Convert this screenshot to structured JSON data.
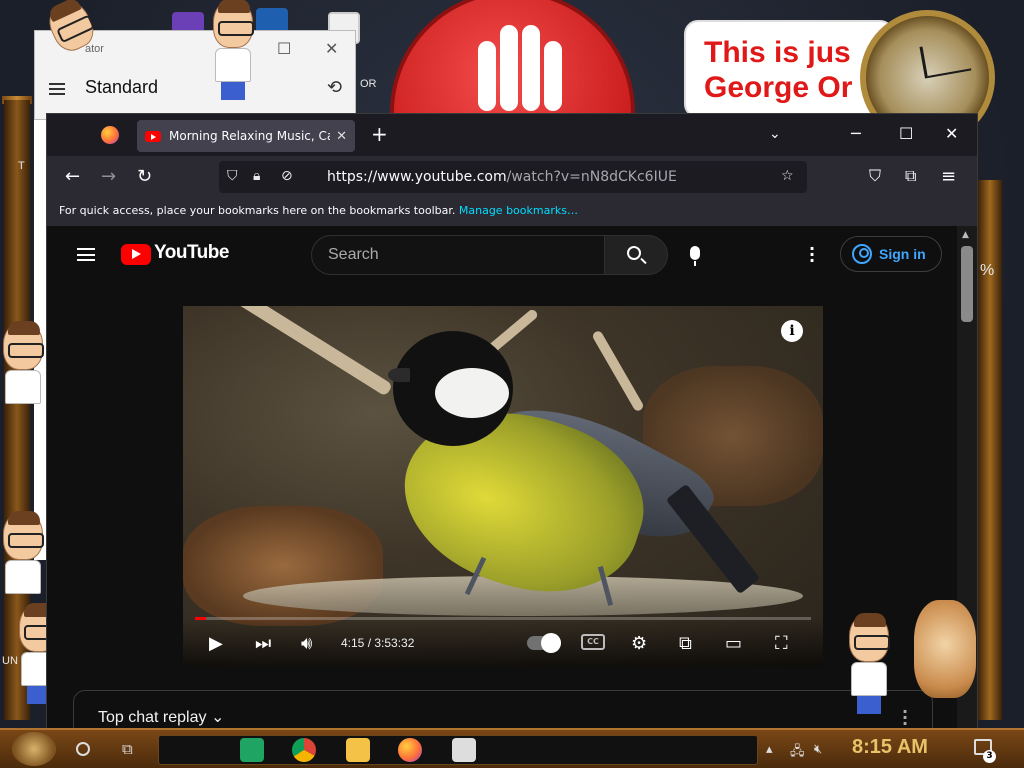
{
  "calculator": {
    "title": "ator",
    "mode": "Standard"
  },
  "desktop": {
    "orwell_line1": "This is jus",
    "orwell_line2": "George Or",
    "side_label_t": "T",
    "side_label_un": "UN",
    "side_label_or": "OR",
    "side_label_pct": "%"
  },
  "browser": {
    "tab_title": "Morning Relaxing Music, Calm",
    "url_host": "https://www.youtube.com",
    "url_path": "/watch?v=nN8dCKc6IUE",
    "bookmarks_text": "For quick access, place your bookmarks here on the bookmarks toolbar.",
    "bookmarks_link": "Manage bookmarks…"
  },
  "youtube": {
    "logo_text": "YouTube",
    "search_placeholder": "Search",
    "sign_in_label": "Sign in",
    "info_glyph": "i",
    "player": {
      "current_time": "4:15",
      "duration": "3:53:32",
      "time_display": "4:15 / 3:53:32",
      "progress_fraction": 0.018,
      "cc_label": "CC"
    },
    "chat_label": "Top chat replay"
  },
  "taskbar": {
    "time": "8:15 AM",
    "notification_count": "3"
  },
  "colors": {
    "youtube_red": "#ff0000",
    "link_blue": "#3ea6ff",
    "firefox_link": "#00ddff",
    "orwell_red": "#e01818",
    "clock_gold": "#e8c36a"
  }
}
